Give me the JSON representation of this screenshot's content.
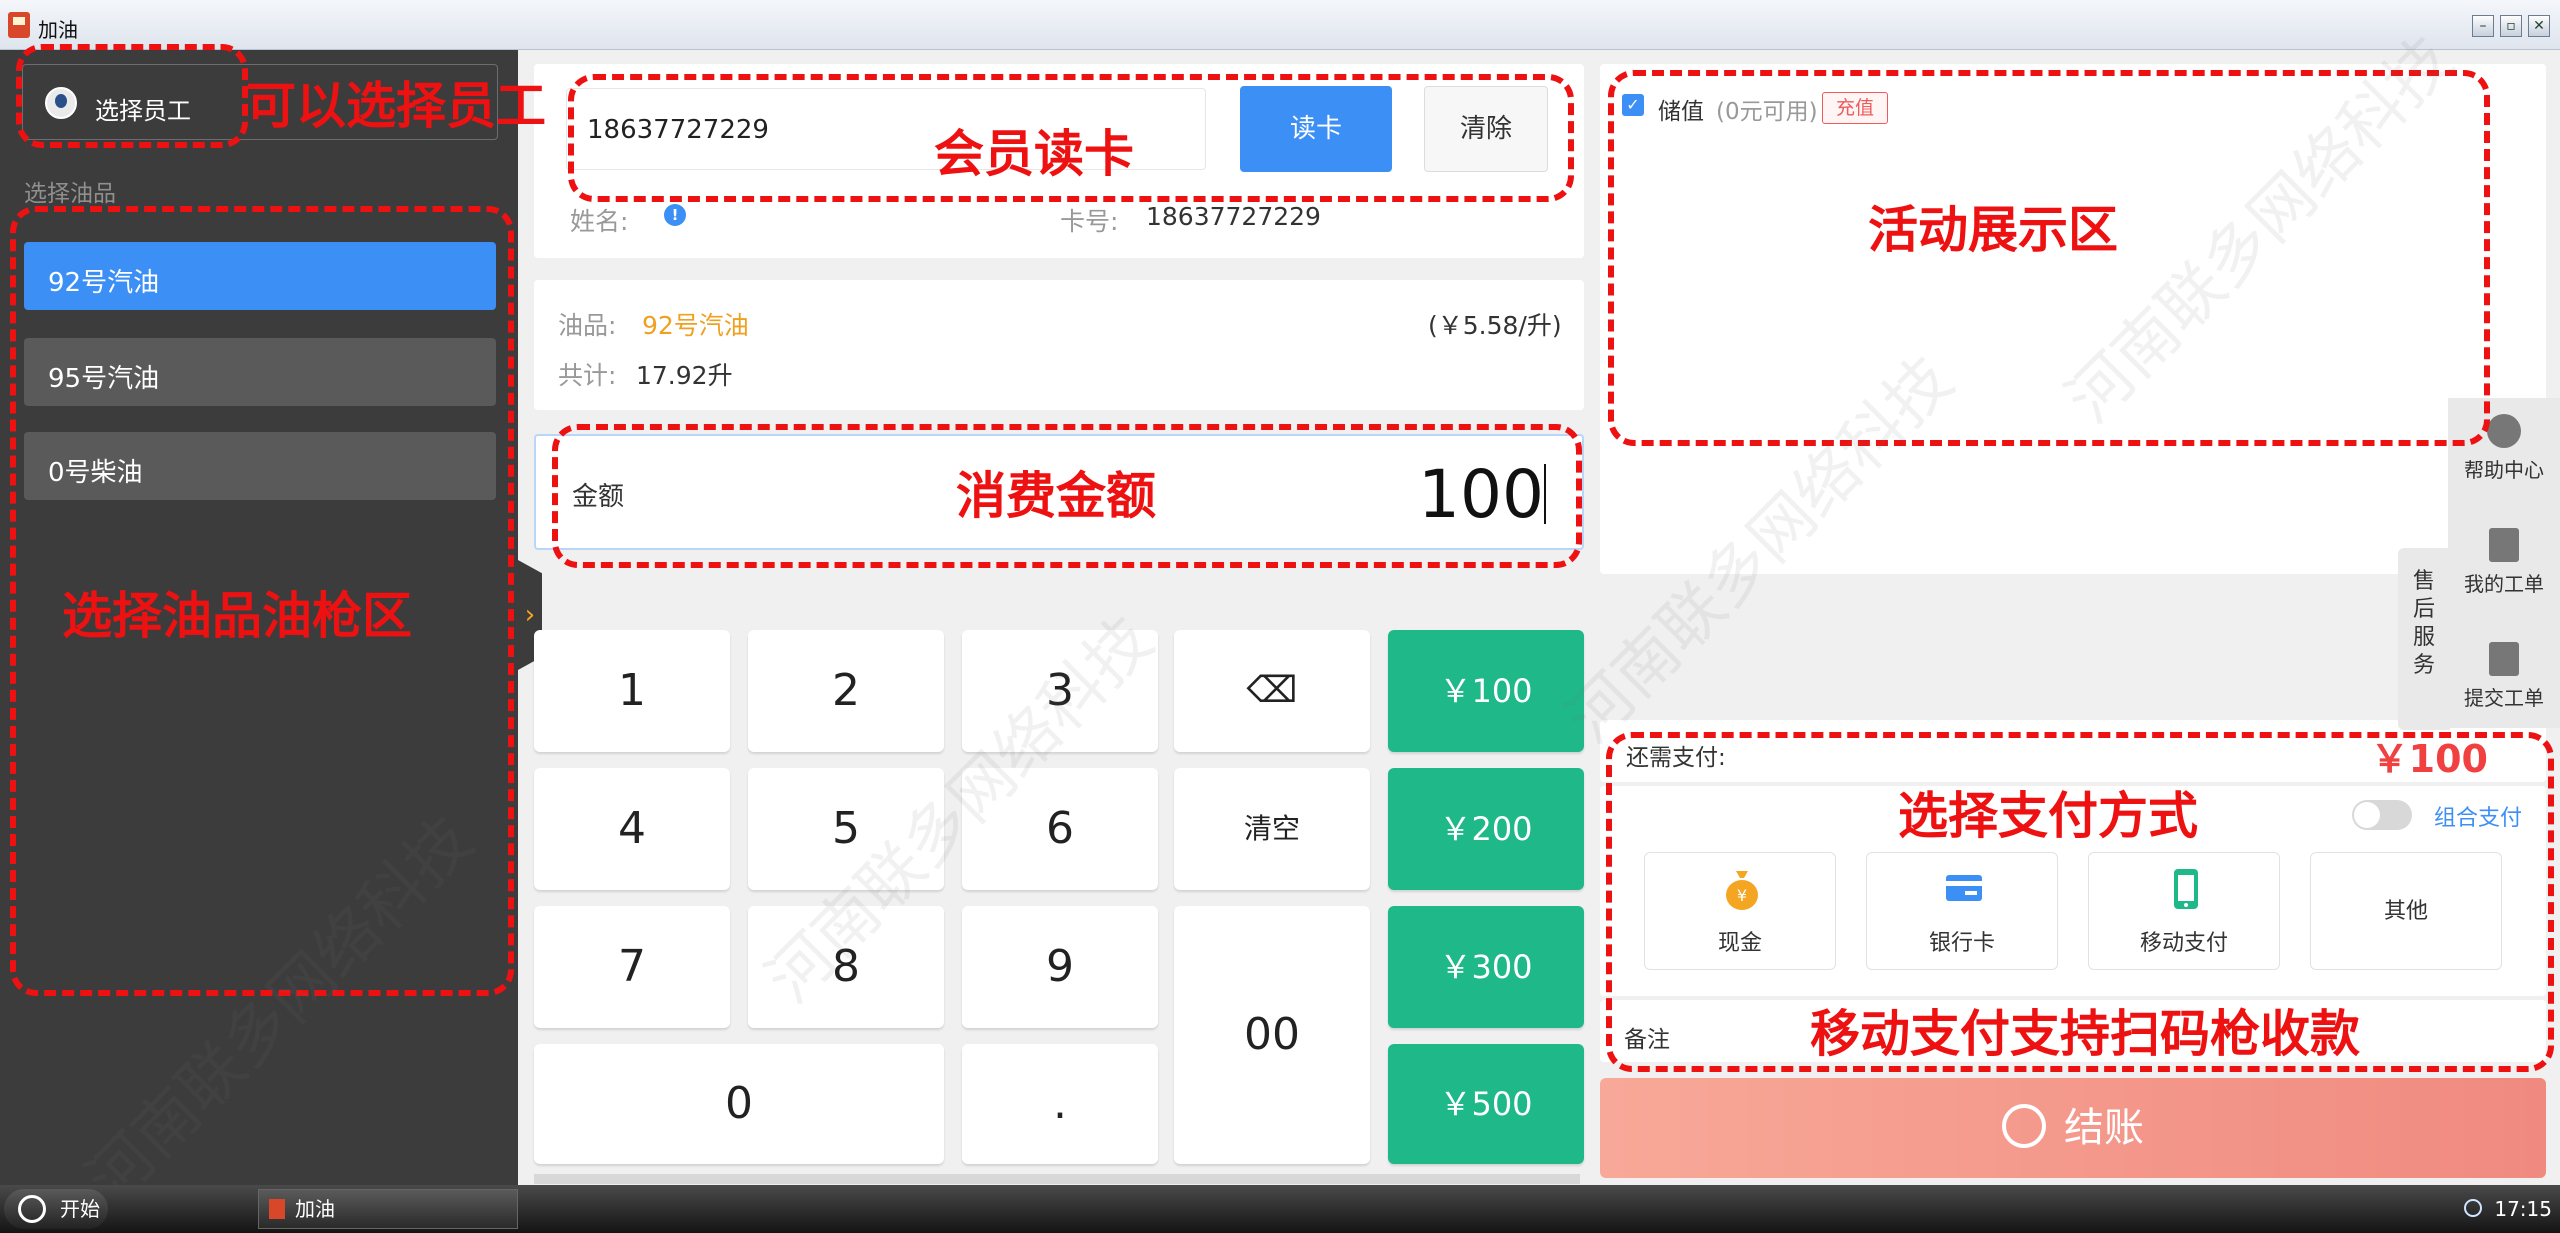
{
  "window": {
    "title": "加油",
    "buttons": [
      "–",
      "▫",
      "✕"
    ]
  },
  "sidebar": {
    "employee_button": "选择员工",
    "section_label": "选择油品",
    "fuels": [
      {
        "label": "92号汽油",
        "active": true
      },
      {
        "label": "95号汽油",
        "active": false
      },
      {
        "label": "0号柴油",
        "active": false
      }
    ],
    "collapse_glyph": "›"
  },
  "member": {
    "card_input": "18637727229",
    "read_button": "读卡",
    "clear_button": "清除",
    "name_label": "姓名:",
    "cardno_label": "卡号:",
    "cardno_value": "18637727229"
  },
  "order": {
    "oil_label": "油品:",
    "oil_value": "92号汽油",
    "price": "(￥5.58/升)",
    "total_label": "共计:",
    "total_value": "17.92升"
  },
  "amount": {
    "label": "金额",
    "value": "100"
  },
  "keypad": {
    "keys": [
      "1",
      "2",
      "3",
      "4",
      "5",
      "6",
      "7",
      "8",
      "9",
      "0",
      ".",
      "00"
    ],
    "backspace": "⌫",
    "clear": "清空",
    "quick": [
      "￥100",
      "￥200",
      "￥300",
      "￥500"
    ]
  },
  "promo": {
    "stored_label": "储值",
    "stored_value": "(0元可用)",
    "recharge": "充值"
  },
  "payment": {
    "due_label": "还需支付:",
    "due_value": "￥100",
    "combo_label": "组合支付",
    "methods": [
      "现金",
      "银行卡",
      "移动支付",
      "其他"
    ],
    "remark_label": "备注",
    "checkout": "结账",
    "colors": {
      "cash": "#f4a623",
      "card": "#3c8ff5",
      "mobile": "#1fb888",
      "due": "#f04040"
    }
  },
  "help": {
    "tab": [
      "售",
      "后",
      "服",
      "务"
    ],
    "items": [
      "帮助中心",
      "我的工单",
      "提交工单"
    ]
  },
  "annotations": [
    "可以选择员工",
    "会员读卡",
    "活动展示区",
    "消费金额",
    "选择油品油枪区",
    "选择支付方式",
    "移动支付支持扫码枪收款"
  ],
  "taskbar": {
    "start": "开始",
    "app": "加油",
    "time": "17:15"
  }
}
